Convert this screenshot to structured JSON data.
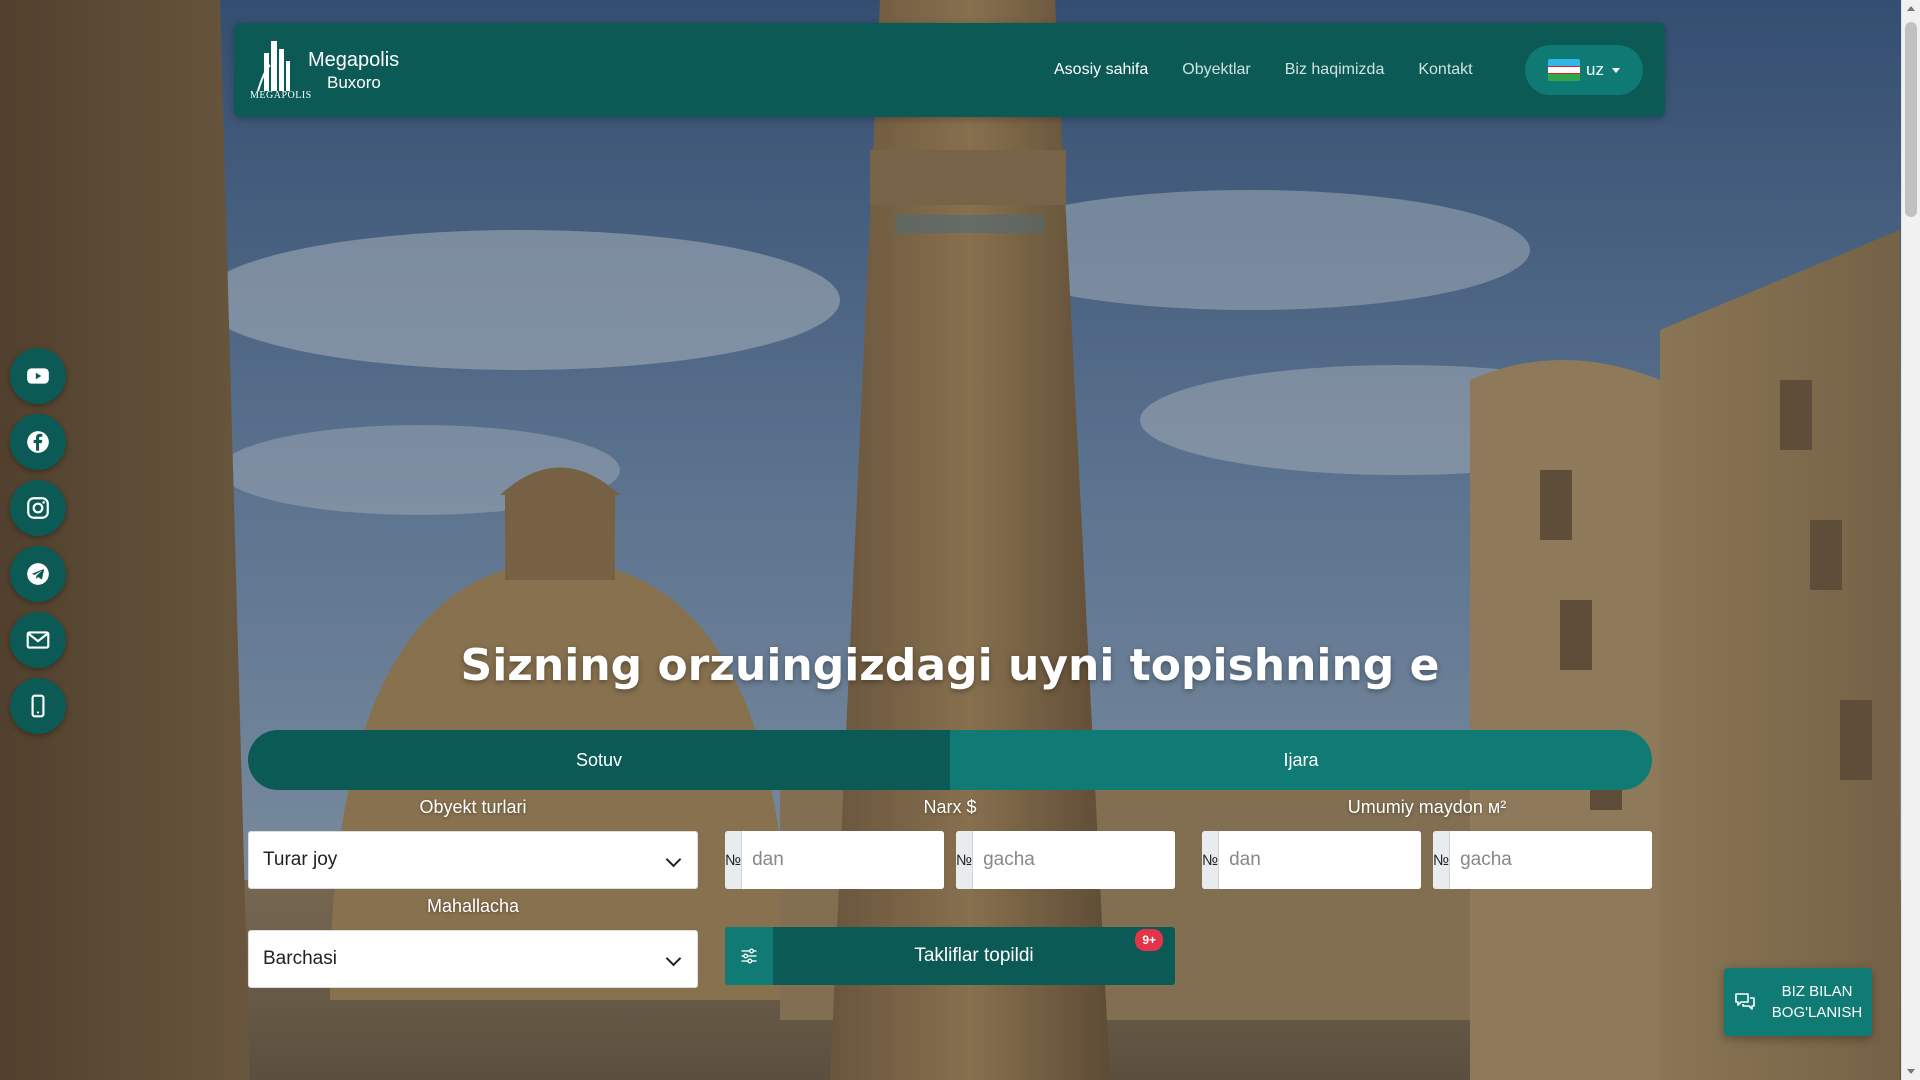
{
  "brand": {
    "mark_caption": "MEGAPOLIS",
    "name_line1": "Megapolis",
    "name_line2": "Buxoro"
  },
  "nav": {
    "links": [
      "Asosiy sahifa",
      "Obyektlar",
      "Biz haqimizda",
      "Kontakt"
    ],
    "active_index": 0,
    "language": "uz"
  },
  "social": [
    "youtube-icon",
    "facebook-icon",
    "instagram-icon",
    "telegram-icon",
    "mail-icon",
    "phone-icon"
  ],
  "hero": {
    "title": "Sizning orzuingizdagi uyni topishning e"
  },
  "tabs": [
    "Sotuv",
    "Ijara"
  ],
  "filters": {
    "object_type_label": "Obyekt turlari",
    "object_type_value": "Turar joy",
    "price_label": "Narx $",
    "area_label": "Umumiy maydon м²",
    "neighborhood_label": "Mahallacha",
    "neighborhood_value": "Barchasi",
    "number_prefix": "№",
    "from_placeholder": "dan",
    "to_placeholder": "gacha"
  },
  "search_button": {
    "label": "Takliflar topildi",
    "badge": "9+"
  },
  "contact_button": {
    "line1": "BIZ BILAN",
    "line2": "BOG'LANISH"
  },
  "colors": {
    "primary": "#0b5a56",
    "primary_light": "#0f7b74",
    "badge": "#e4344a"
  }
}
